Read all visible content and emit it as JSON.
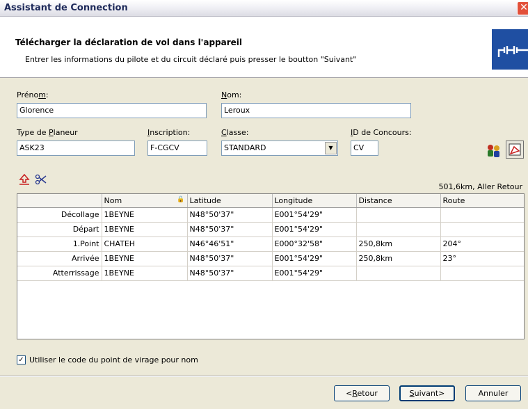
{
  "window": {
    "title": "Assistant de Connection"
  },
  "header": {
    "title": "Télécharger  la déclaration de vol dans l'appareil",
    "subtitle": "Entrer les informations du pilote et du circuit déclaré puis presser le boutton \"Suivant\"",
    "icon": "connector-plug-icon"
  },
  "form": {
    "prenom": {
      "label_pre": "Préno",
      "label_ul": "m",
      "label_post": ":",
      "value": "Glorence"
    },
    "nom": {
      "label_ul": "N",
      "label_post": "om:",
      "value": "Leroux"
    },
    "type_planeur": {
      "label_pre": "Type de ",
      "label_ul": "P",
      "label_post": "laneur",
      "value": "ASK23"
    },
    "inscription": {
      "label_ul": "I",
      "label_post": "nscription:",
      "value": "F-CGCV"
    },
    "classe": {
      "label_ul": "C",
      "label_post": "lasse:",
      "value": "STANDARD"
    },
    "id_concours": {
      "label_ul": "I",
      "label_post": "D de Concours:",
      "value": "CV"
    }
  },
  "task": {
    "summary": "501,6km, Aller Retour"
  },
  "table": {
    "columns": [
      "",
      "Nom",
      "Latitude",
      "Longitude",
      "Distance",
      "Route"
    ],
    "rows": [
      [
        "Décollage",
        "1BEYNE",
        "N48°50'37\"",
        "E001°54'29\"",
        "",
        ""
      ],
      [
        "Départ",
        "1BEYNE",
        "N48°50'37\"",
        "E001°54'29\"",
        "",
        ""
      ],
      [
        "1.Point",
        "CHATEH",
        "N46°46'51\"",
        "E000°32'58\"",
        "250,8km",
        "204°"
      ],
      [
        "Arrivée",
        "1BEYNE",
        "N48°50'37\"",
        "E001°54'29\"",
        "250,8km",
        "23°"
      ],
      [
        "Atterrissage",
        "1BEYNE",
        "N48°50'37\"",
        "E001°54'29\"",
        "",
        ""
      ]
    ]
  },
  "option": {
    "checked": true,
    "label": "Utiliser le code du point de virage pour nom"
  },
  "buttons": {
    "back": {
      "pre": "<",
      "ul": "R",
      "post": "etour"
    },
    "next": {
      "ul": "S",
      "post": "uivant>"
    },
    "cancel": "Annuler"
  },
  "colors": {
    "header_icon_bg": "#1f4fa2",
    "field_border": "#7f9db9",
    "close_red": "#e2503a"
  }
}
